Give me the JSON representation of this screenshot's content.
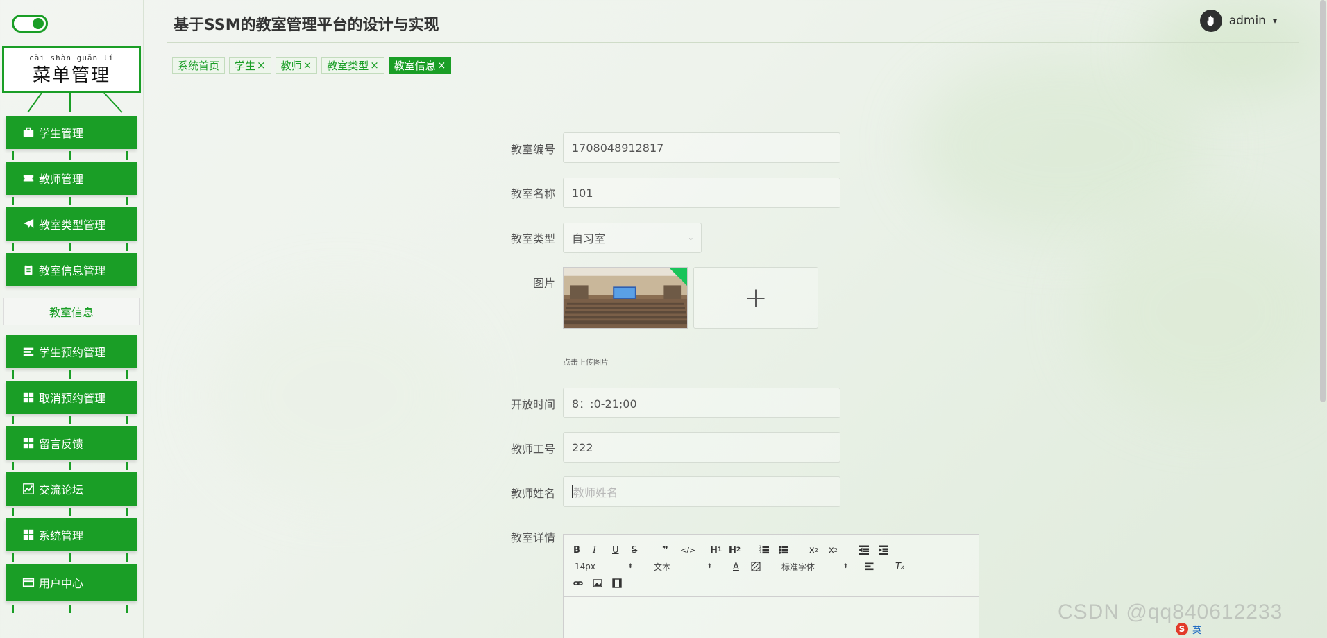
{
  "app": {
    "title": "基于SSM的教室管理平台的设计与实现"
  },
  "user": {
    "name": "admin",
    "chevron": "⌄"
  },
  "sidebar": {
    "title_pinyin": "cài shàn guǎn lǐ",
    "title": "菜单管理",
    "items": [
      {
        "label": "学生管理",
        "icon": "briefcase-icon"
      },
      {
        "label": "教师管理",
        "icon": "ticket-icon"
      },
      {
        "label": "教室类型管理",
        "icon": "paper-plane-icon"
      },
      {
        "label": "教室信息管理",
        "icon": "clipboard-icon"
      },
      {
        "label": "学生预约管理",
        "icon": "list-icon"
      },
      {
        "label": "取消预约管理",
        "icon": "grid-icon"
      },
      {
        "label": "留言反馈",
        "icon": "grid-icon"
      },
      {
        "label": "交流论坛",
        "icon": "chart-icon"
      },
      {
        "label": "系统管理",
        "icon": "grid-icon"
      },
      {
        "label": "用户中心",
        "icon": "card-icon"
      }
    ],
    "active_subitem": "教室信息"
  },
  "tags": [
    {
      "label": "系统首页",
      "closable": false,
      "active": false
    },
    {
      "label": "学生",
      "closable": true,
      "active": false
    },
    {
      "label": "教师",
      "closable": true,
      "active": false
    },
    {
      "label": "教室类型",
      "closable": true,
      "active": false
    },
    {
      "label": "教室信息",
      "closable": true,
      "active": true
    }
  ],
  "form": {
    "room_no": {
      "label": "教室编号",
      "value": "1708048912817"
    },
    "room_name": {
      "label": "教室名称",
      "value": "101"
    },
    "room_type": {
      "label": "教室类型",
      "value": "自习室"
    },
    "image": {
      "label": "图片",
      "hint": "点击上传图片",
      "plus": "+"
    },
    "open_time": {
      "label": "开放时间",
      "value": "8：:0-21;00"
    },
    "teacher_no": {
      "label": "教师工号",
      "value": "222"
    },
    "teacher_name": {
      "label": "教师姓名",
      "value": "",
      "placeholder": "教师姓名"
    },
    "details": {
      "label": "教室详情"
    }
  },
  "editor": {
    "font_size": "14px",
    "block_type": "文本",
    "font_family": "标准字体",
    "buttons": [
      "B",
      "I",
      "U",
      "S",
      "❞",
      "</>",
      "H1",
      "H2",
      "ol",
      "ul",
      "x₂",
      "x²",
      "outdent",
      "indent",
      "A",
      "bg",
      "align",
      "Tx",
      "link",
      "image",
      "video"
    ]
  },
  "colors": {
    "accent": "#1a9e26",
    "active_tag": "#1a9e26"
  },
  "watermark": "CSDN @qq840612233",
  "ime": {
    "lang": "英"
  }
}
